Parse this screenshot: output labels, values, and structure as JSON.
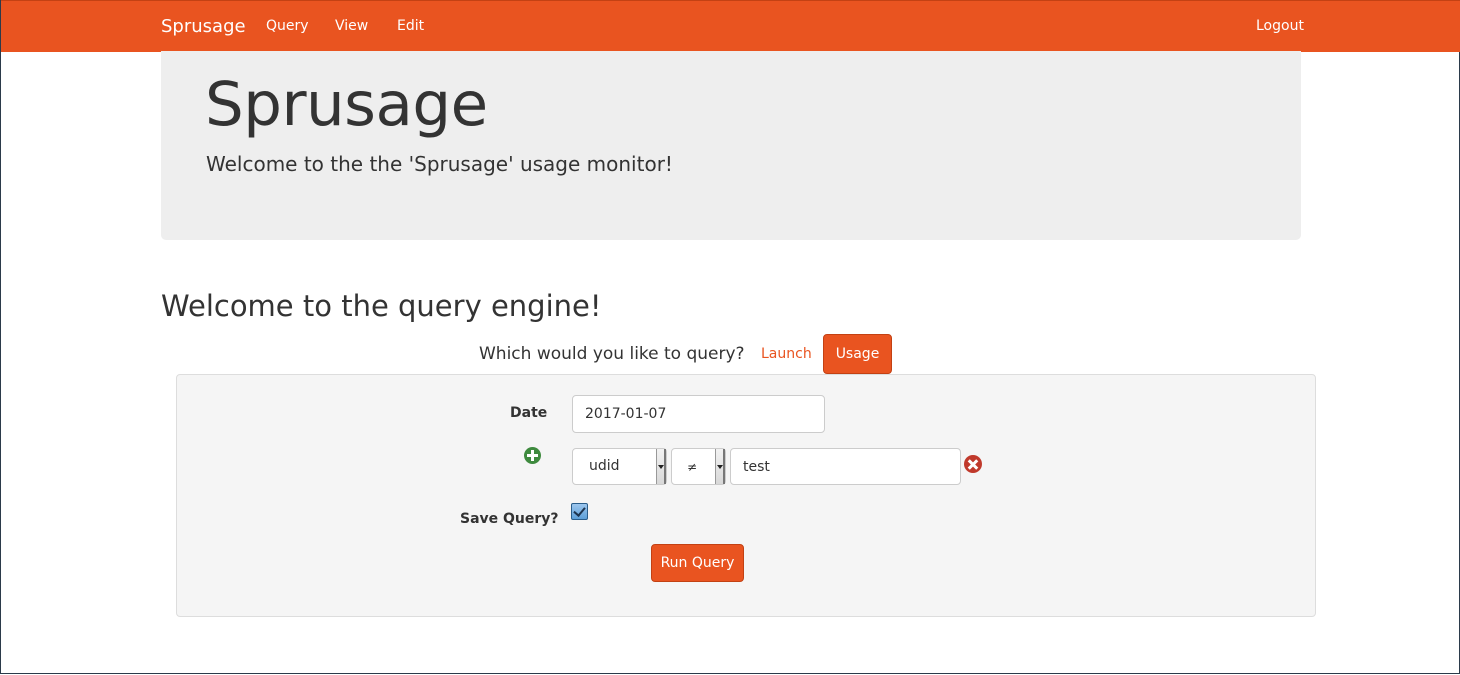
{
  "navbar": {
    "brand": "Sprusage",
    "links": [
      "Query",
      "View",
      "Edit"
    ],
    "logout": "Logout",
    "color": "#e95420"
  },
  "jumbotron": {
    "title": "Sprusage",
    "subtitle": "Welcome to the the 'Sprusage' usage monitor!"
  },
  "main": {
    "title": "Welcome to the query engine!",
    "question": "Which would you like to query?",
    "options": {
      "launch": "Launch",
      "usage": "Usage",
      "selected": "Usage"
    }
  },
  "form": {
    "date_label": "Date",
    "date_value": "2017-01-07",
    "filter": {
      "field": "udid",
      "operator": "≠",
      "value": "test"
    },
    "save_label": "Save Query?",
    "save_checked": true,
    "run_button": "Run Query"
  },
  "icons": {
    "add": "plus-circle-icon",
    "remove": "remove-circle-icon"
  }
}
